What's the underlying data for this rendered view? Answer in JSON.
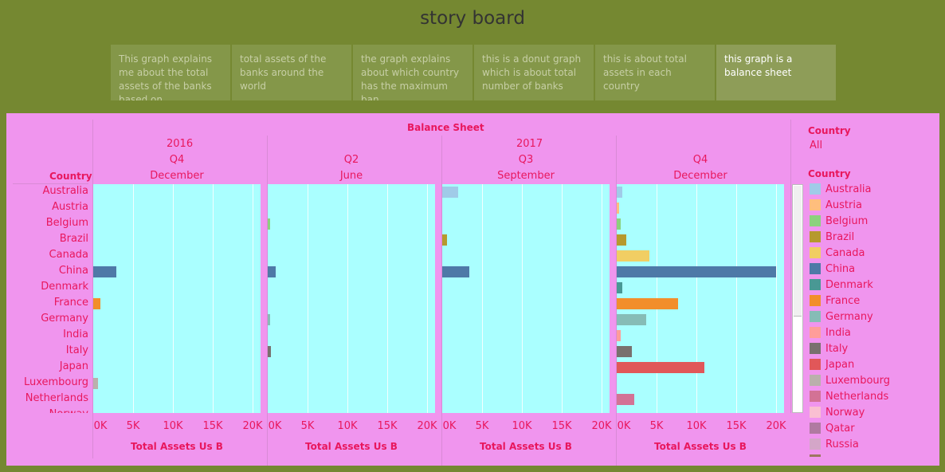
{
  "header": {
    "title": "story board"
  },
  "story_tabs": [
    {
      "label": "This graph explains me about the total assets of the banks based on..",
      "active": false
    },
    {
      "label": "total assets of the banks around the world",
      "active": false
    },
    {
      "label": "the graph explains about which country has the maximum ban..",
      "active": false
    },
    {
      "label": "this is a donut graph which is about total number of banks",
      "active": false
    },
    {
      "label": "this is about total assets in each country",
      "active": false
    },
    {
      "label": "this graph is a balance sheet",
      "active": true
    }
  ],
  "sheet": {
    "title": "Balance Sheet",
    "year_2016": "2016",
    "year_2017": "2017",
    "row_header": "Country",
    "axis_label": "Total Assets Us B",
    "ticks": [
      "0K",
      "5K",
      "10K",
      "15K",
      "20K"
    ],
    "partial_row_label": "Norway"
  },
  "filter": {
    "title": "Country",
    "value": "All"
  },
  "legend": {
    "title": "Country"
  },
  "colors": {
    "Australia": "#a0cbe8",
    "Austria": "#ffbe7d",
    "Belgium": "#8cd17d",
    "Brazil": "#b6992d",
    "Canada": "#f1ce63",
    "China": "#4e79a7",
    "Denmark": "#499894",
    "France": "#f28e2b",
    "Germany": "#86bcb6",
    "India": "#ff9d9a",
    "Italy": "#79706e",
    "Japan": "#e15759",
    "Luxembourg": "#bab0ac",
    "Netherlands": "#d37295",
    "Norway": "#fabfd2",
    "Qatar": "#b07aa1",
    "Russia": "#d4a6c8",
    "Other": "#9d7660"
  },
  "chart_data": {
    "type": "bar",
    "title": "Balance Sheet",
    "orientation": "horizontal",
    "xlabel": "Total Assets Us B",
    "ylabel": "Country",
    "xlim": [
      0,
      21000
    ],
    "categories": [
      "Australia",
      "Austria",
      "Belgium",
      "Brazil",
      "Canada",
      "China",
      "Denmark",
      "France",
      "Germany",
      "India",
      "Italy",
      "Japan",
      "Luxembourg",
      "Netherlands"
    ],
    "panels": [
      {
        "year": "2016",
        "quarter": "Q4",
        "month": "December",
        "values": [
          0,
          0,
          0,
          0,
          0,
          2900,
          0,
          900,
          0,
          0,
          0,
          0,
          600,
          0
        ]
      },
      {
        "year": "2017",
        "quarter": "Q2",
        "month": "June",
        "values": [
          0,
          0,
          200,
          0,
          0,
          1000,
          0,
          0,
          250,
          0,
          400,
          0,
          0,
          0
        ]
      },
      {
        "year": "2017",
        "quarter": "Q3",
        "month": "September",
        "values": [
          2000,
          0,
          0,
          600,
          0,
          3400,
          0,
          0,
          0,
          0,
          0,
          0,
          0,
          0
        ]
      },
      {
        "year": "2017",
        "quarter": "Q4",
        "month": "December",
        "values": [
          700,
          200,
          500,
          1200,
          4100,
          20000,
          700,
          7700,
          3700,
          500,
          1900,
          11000,
          0,
          2200
        ]
      }
    ],
    "legend": [
      "Australia",
      "Austria",
      "Belgium",
      "Brazil",
      "Canada",
      "China",
      "Denmark",
      "France",
      "Germany",
      "India",
      "Italy",
      "Japan",
      "Luxembourg",
      "Netherlands",
      "Norway",
      "Qatar",
      "Russia"
    ]
  }
}
